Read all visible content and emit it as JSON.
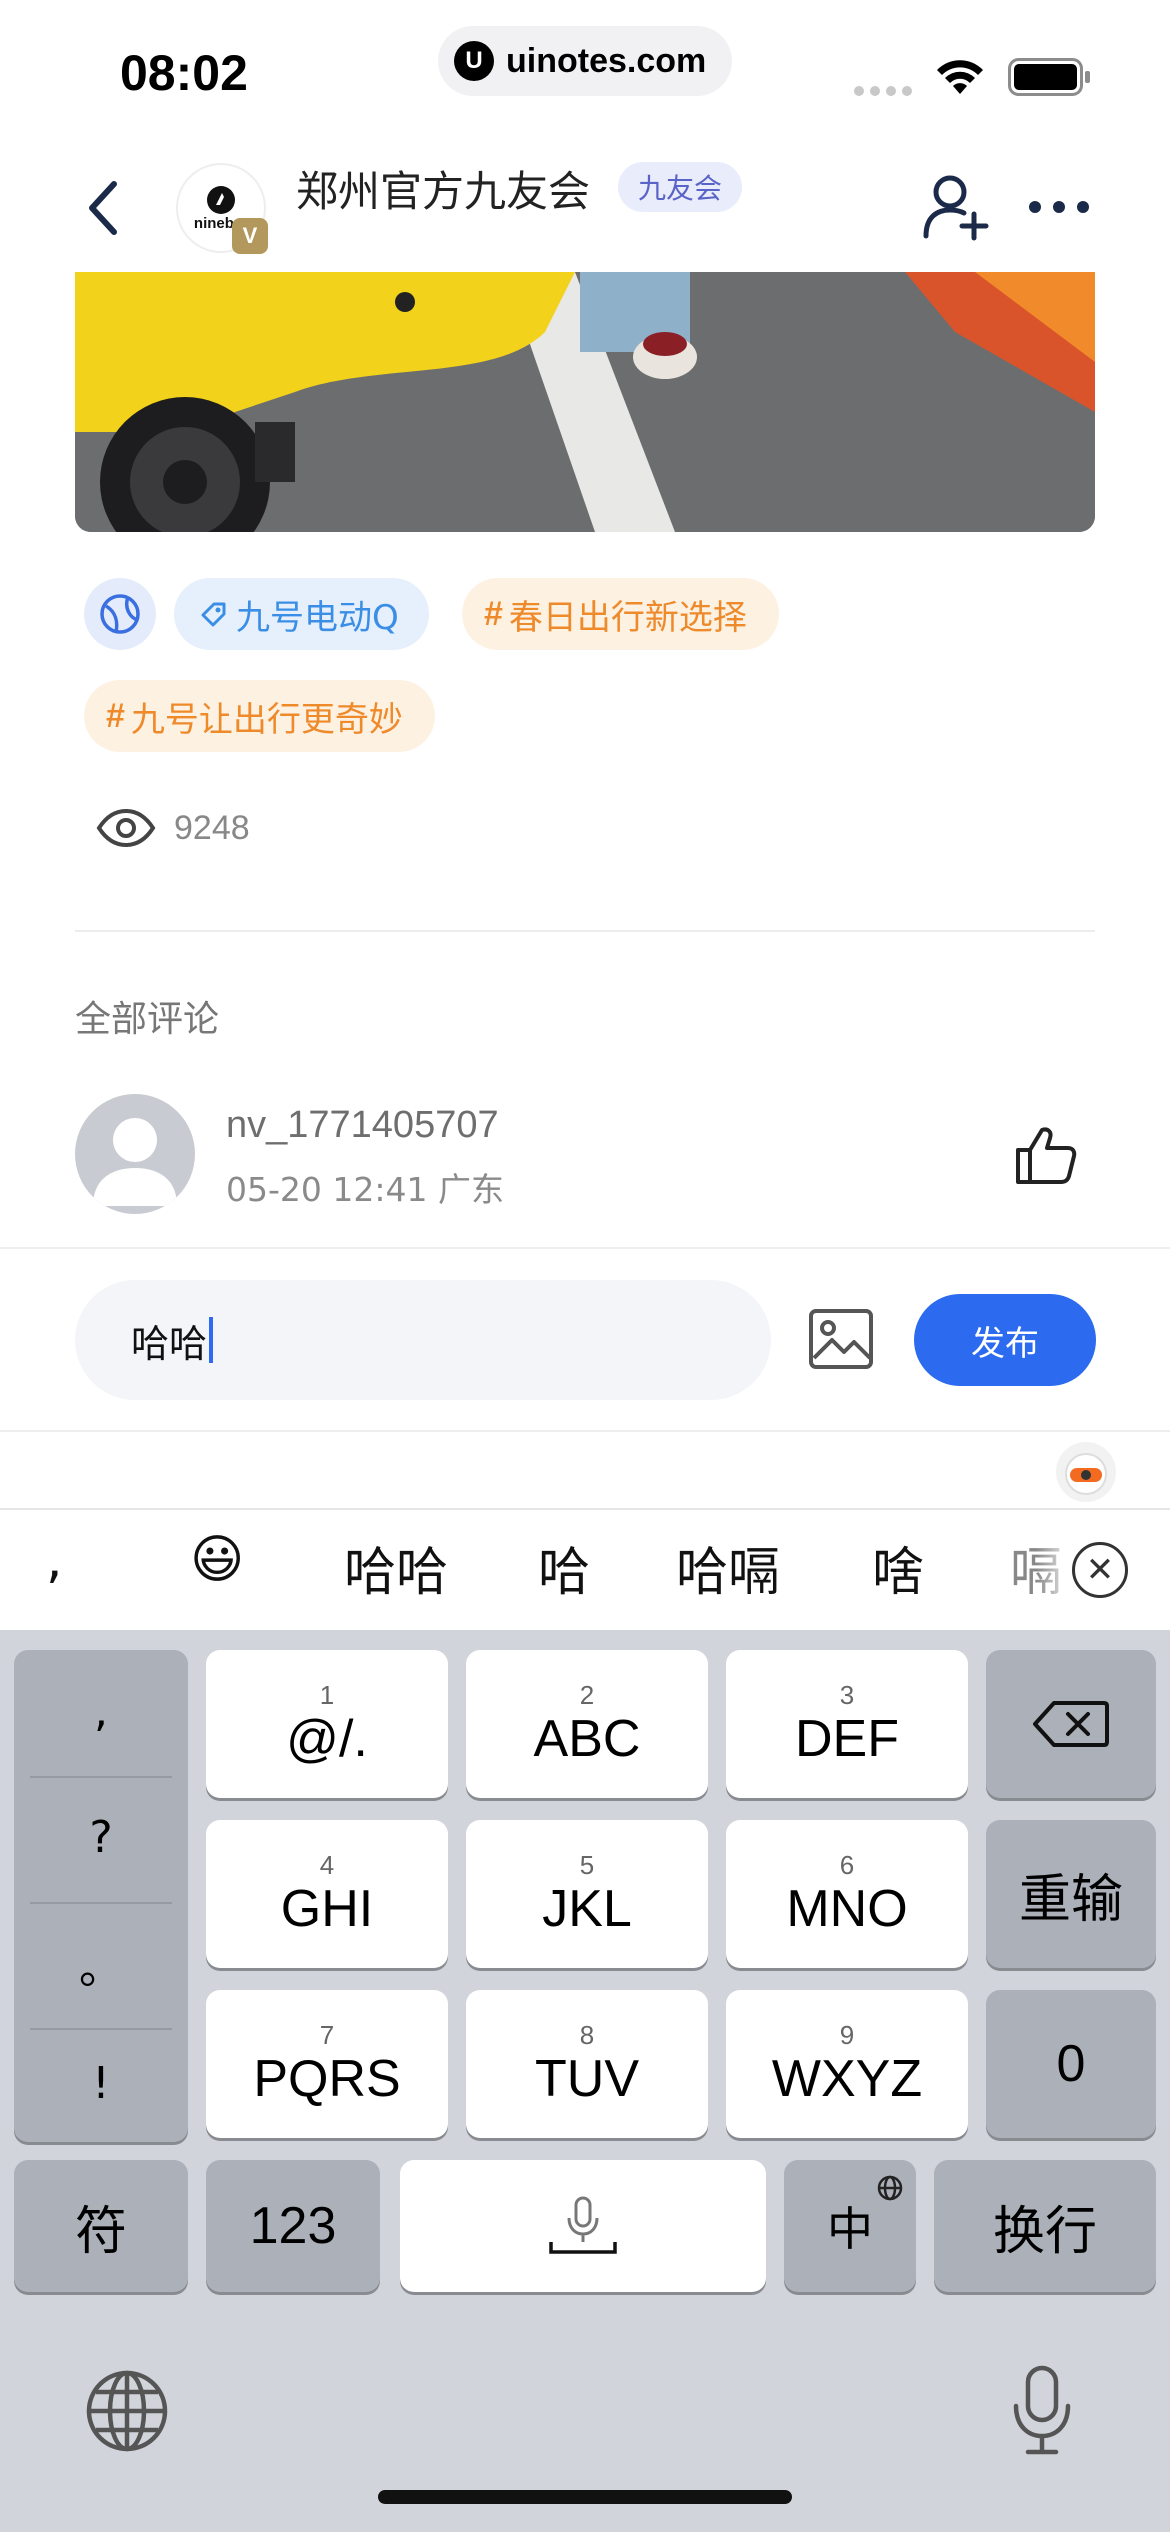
{
  "status_bar": {
    "time": "08:02",
    "url": "uinotes.com"
  },
  "header": {
    "group_name": "郑州官方九友会",
    "group_tag": "九友会",
    "logo_text": "ninebot",
    "badge": "V"
  },
  "tags": {
    "product": "九号电动Q",
    "topic1": "春日出行新选择",
    "topic2": "九号让出行更奇妙",
    "hash": "#"
  },
  "views": {
    "count": "9248"
  },
  "comments": {
    "title": "全部评论",
    "items": [
      {
        "username": "nv_1771405707",
        "meta": "05-20 12:41  广东"
      }
    ]
  },
  "input": {
    "value": "哈哈",
    "publish_label": "发布"
  },
  "candidates": {
    "items": [
      ",",
      "😃",
      "哈哈",
      "哈",
      "哈嗝",
      "啥",
      "嗝"
    ]
  },
  "keyboard": {
    "punct": [
      ",",
      "?",
      "。",
      "!"
    ],
    "keys": [
      {
        "num": "1",
        "label": "@/."
      },
      {
        "num": "2",
        "label": "ABC"
      },
      {
        "num": "3",
        "label": "DEF"
      },
      {
        "num": "4",
        "label": "GHI"
      },
      {
        "num": "5",
        "label": "JKL"
      },
      {
        "num": "6",
        "label": "MNO"
      },
      {
        "num": "7",
        "label": "PQRS"
      },
      {
        "num": "8",
        "label": "TUV"
      },
      {
        "num": "9",
        "label": "WXYZ"
      }
    ],
    "reenter": "重输",
    "zero": "0",
    "symbols": "符",
    "numbers": "123",
    "lang": "中",
    "return": "换行"
  },
  "colors": {
    "accent": "#2c6bf0",
    "tag_orange": "#ef8a2b",
    "tag_blue": "#3b8ee6"
  }
}
